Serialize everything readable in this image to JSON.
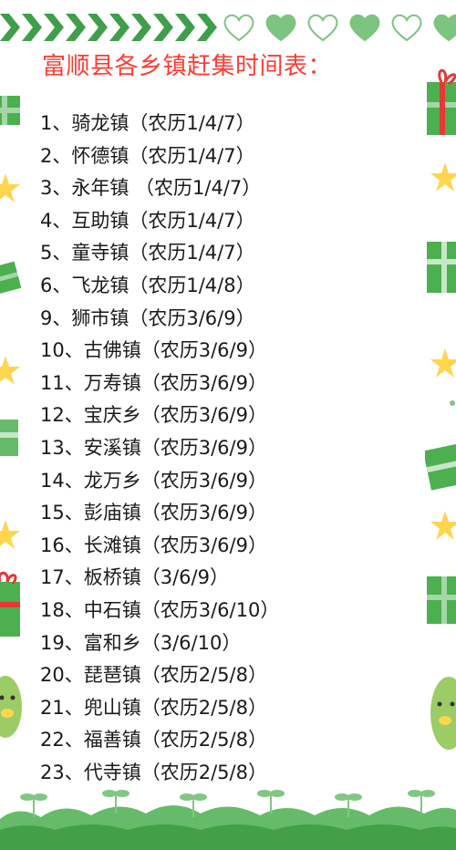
{
  "title": "富顺县各乡镇赶集时间表：",
  "entries": [
    "1、骑龙镇（农历1/4/7）",
    "2、怀德镇（农历1/4/7）",
    "3、永年镇 （农历1/4/7）",
    "4、互助镇（农历1/4/7）",
    "5、童寺镇（农历1/4/7）",
    "6、飞龙镇（农历1/4/8）",
    "9、狮市镇（农历3/6/9）",
    "10、古佛镇（农历3/6/9）",
    "11、万寿镇（农历3/6/9）",
    "12、宝庆乡（农历3/6/9）",
    "13、安溪镇（农历3/6/9）",
    "14、龙万乡（农历3/6/9）",
    "15、彭庙镇（农历3/6/9）",
    "16、长滩镇（农历3/6/9）",
    "17、板桥镇（3/6/9）",
    "18、中石镇（农历3/6/10）",
    "19、富和乡（3/6/10）",
    "20、琵琶镇（农历2/5/8）",
    "21、兜山镇（农历2/5/8）",
    "22、福善镇（农历2/5/8）",
    "23、代寺镇（农历2/5/8）"
  ],
  "colors": {
    "title": "#ff3b30",
    "text": "#1a1a1a",
    "green": "#4caf50",
    "light_green": "#a5d6a7",
    "star": "#ffd54f",
    "gift_red": "#e53935"
  }
}
